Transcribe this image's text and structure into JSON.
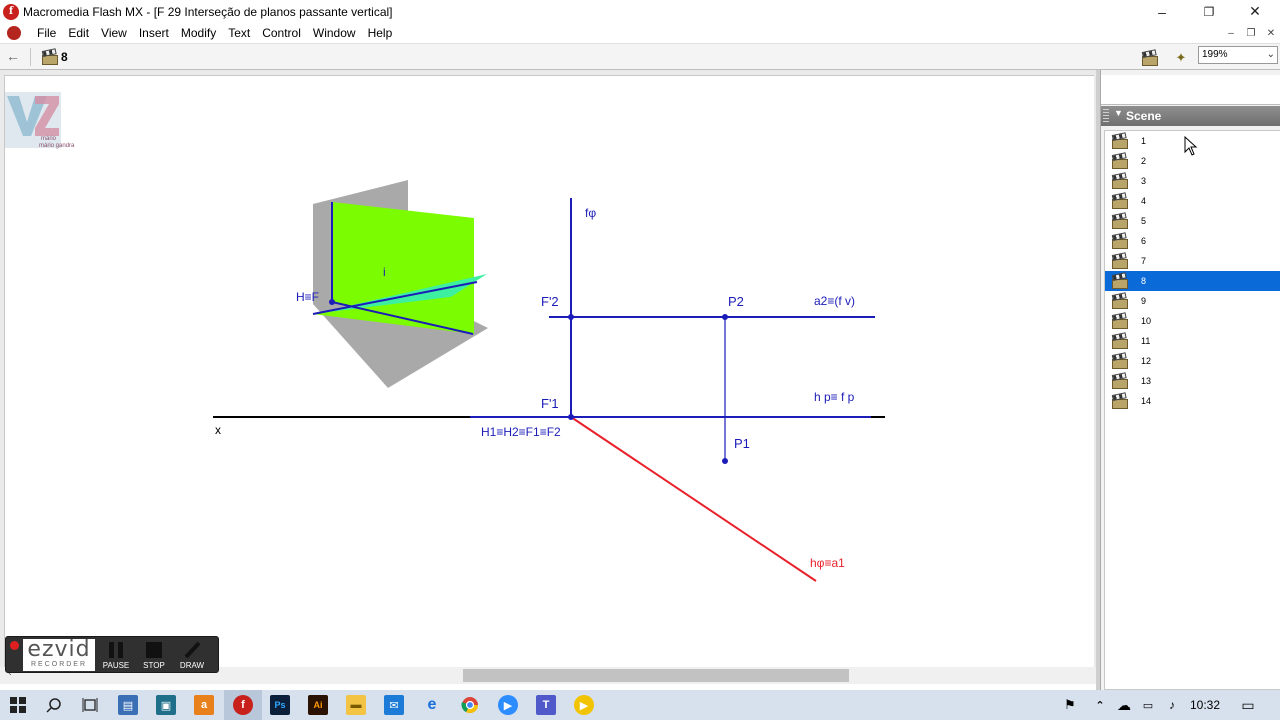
{
  "window": {
    "title": "Macromedia Flash MX - [F 29 Interseção de planos passante vertical]",
    "controls": {
      "minimize": "–",
      "restore": "❐",
      "close": "✕"
    }
  },
  "menubar": {
    "items": [
      "File",
      "Edit",
      "View",
      "Insert",
      "Modify",
      "Text",
      "Control",
      "Window",
      "Help"
    ],
    "mdi_controls": {
      "minimize": "–",
      "restore": "❐",
      "close": "✕"
    }
  },
  "editbar": {
    "back_icon": "back-arrow-icon",
    "current_scene": "8",
    "zoom": "199%"
  },
  "stage": {
    "logo_text": "mário gandra",
    "labels": {
      "plane_i": "i",
      "h_eq_f": "H≡F",
      "f_phi": "fφ",
      "f2": "F'2",
      "p2": "P2",
      "a2": "a2≡(f  v)",
      "f1": "F'1",
      "h_line": "h p≡  f p",
      "x": "x",
      "h1_chain": "H1≡H2≡F1≡F2",
      "p1": "P1",
      "h_phi": "hφ≡a1"
    },
    "colors": {
      "blue": "#1c1cb8",
      "red": "#e8212b",
      "green": "#7cfc00",
      "teal": "#3cf0a0",
      "gray": "#a9a9a9"
    }
  },
  "scene_panel": {
    "title": "Scene",
    "selected": "8",
    "scenes": [
      "1",
      "2",
      "3",
      "4",
      "5",
      "6",
      "7",
      "8",
      "9",
      "10",
      "11",
      "12",
      "13",
      "14"
    ]
  },
  "ezvid": {
    "logo": "ezvid",
    "sub": "RECORDER",
    "pause": "PAUSE",
    "stop": "STOP",
    "draw": "DRAW"
  },
  "taskbar": {
    "time": "10:32"
  }
}
